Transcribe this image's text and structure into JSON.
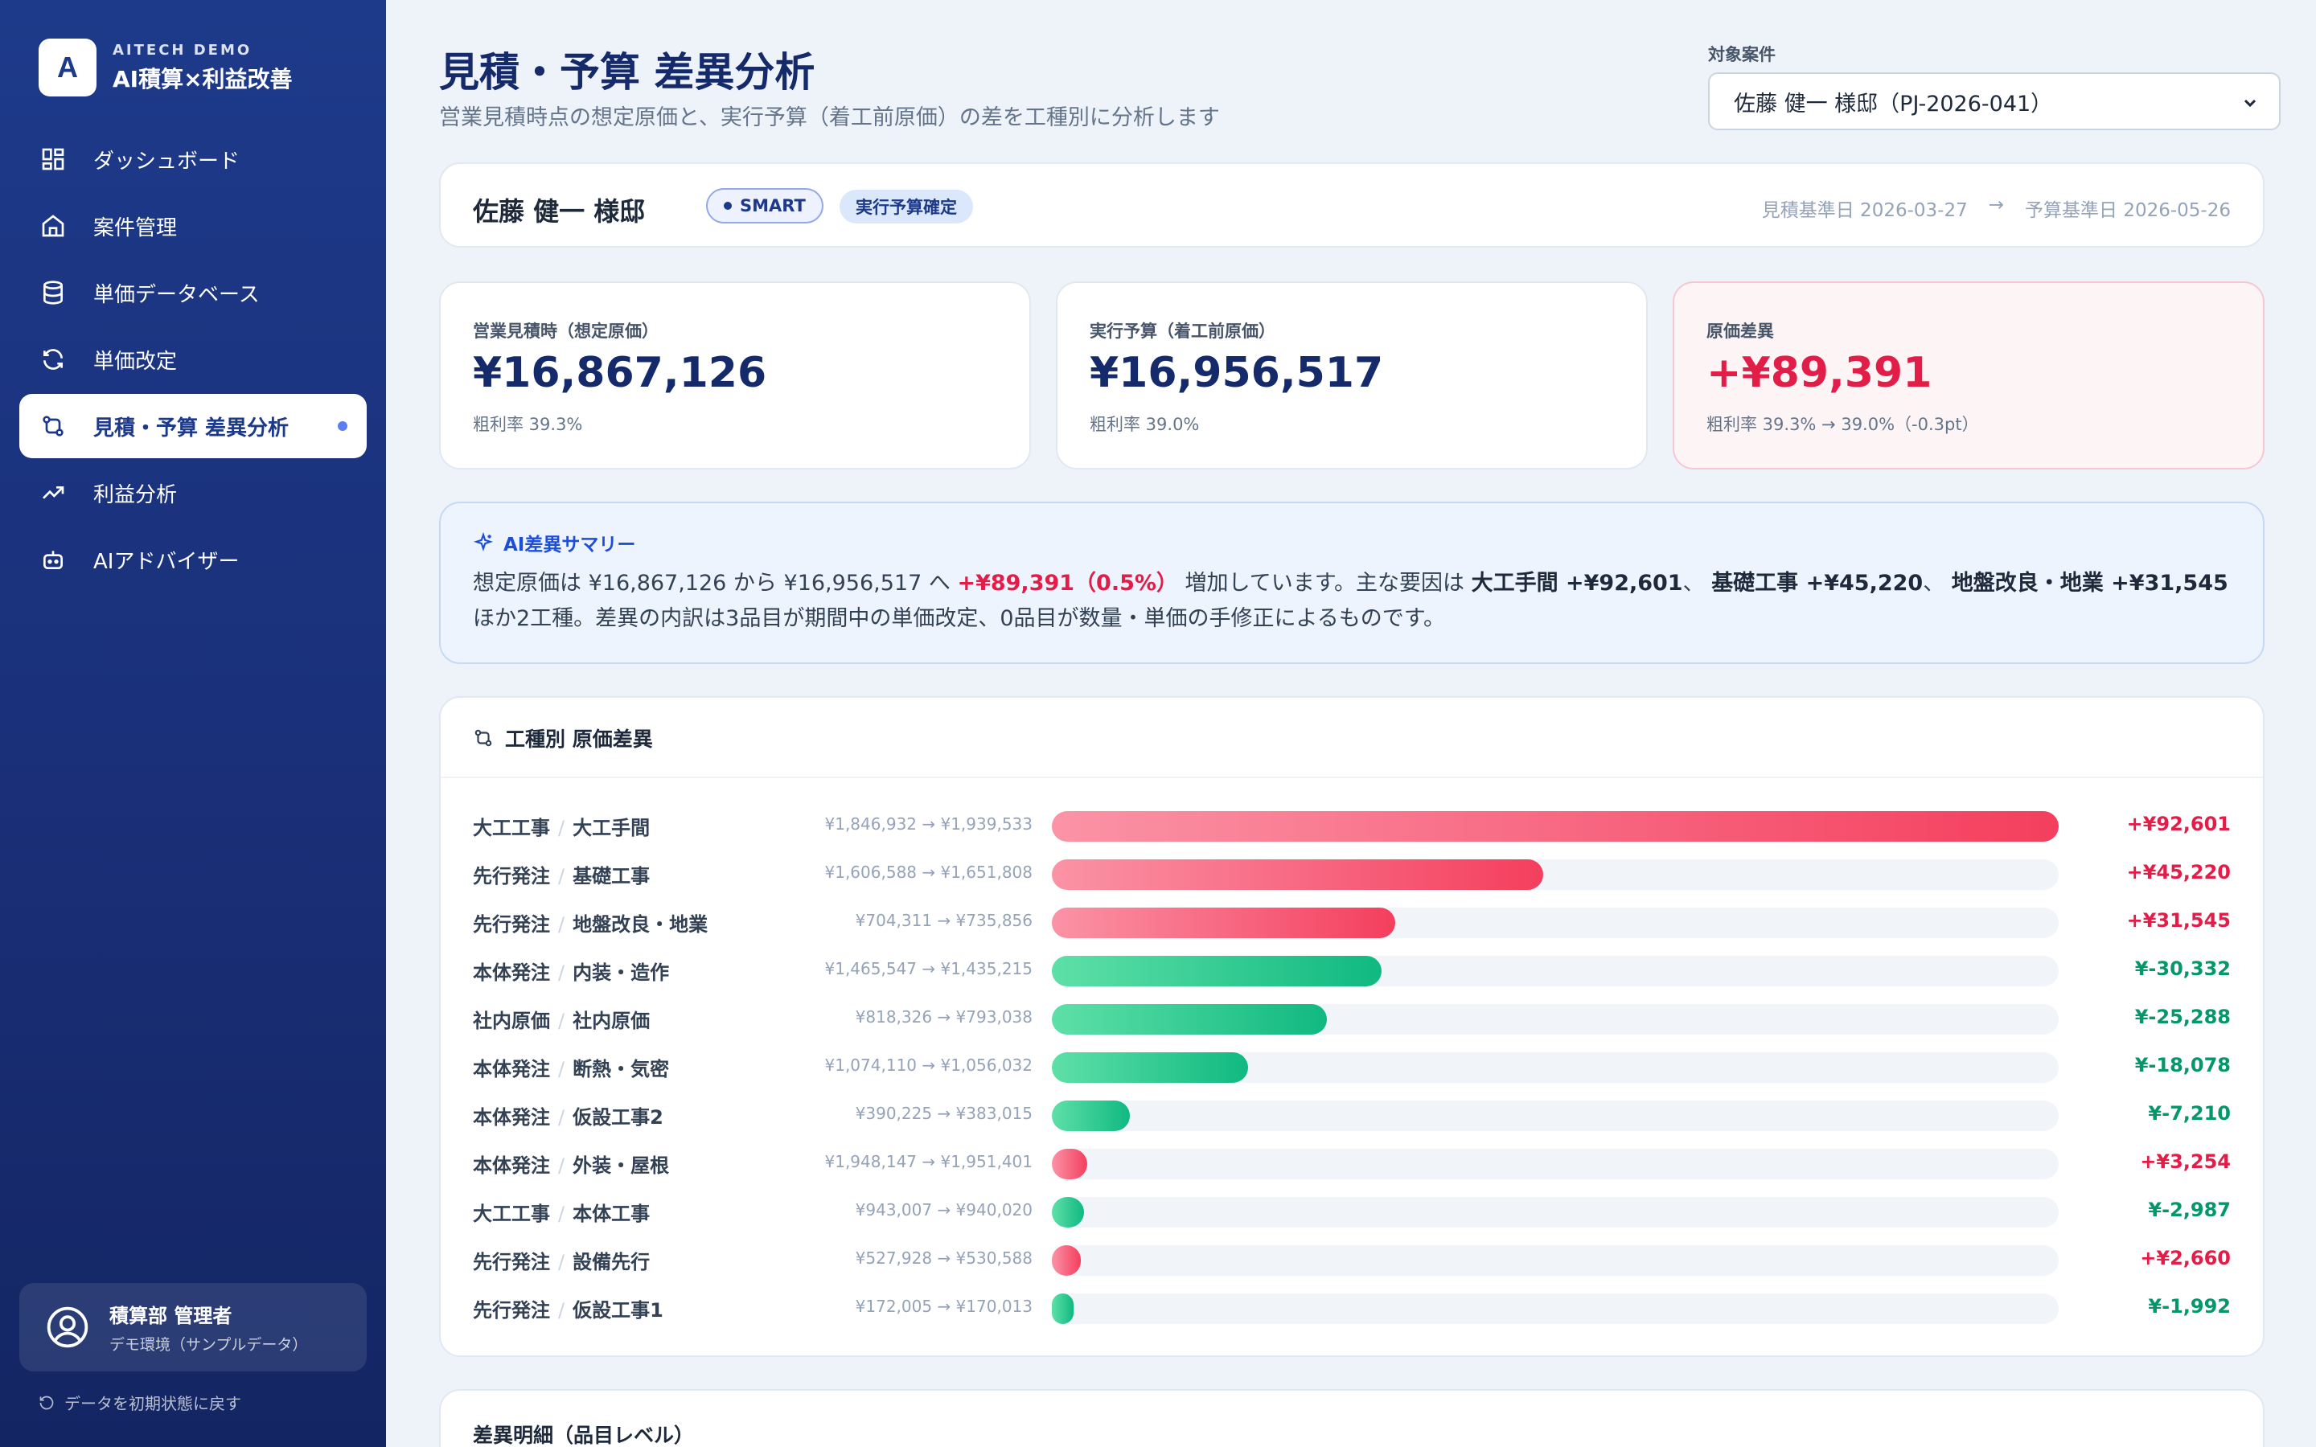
{
  "brand": {
    "logo": "A",
    "sub": "AITECH DEMO",
    "name": "AI積算×利益改善"
  },
  "nav": [
    {
      "label": "ダッシュボード",
      "icon": "dashboard-icon"
    },
    {
      "label": "案件管理",
      "icon": "home-icon"
    },
    {
      "label": "単価データベース",
      "icon": "database-icon"
    },
    {
      "label": "単価改定",
      "icon": "refresh-icon"
    },
    {
      "label": "見積・予算 差異分析",
      "icon": "compare-icon",
      "active": true
    },
    {
      "label": "利益分析",
      "icon": "trend-icon"
    },
    {
      "label": "AIアドバイザー",
      "icon": "robot-icon"
    }
  ],
  "user": {
    "name": "積算部 管理者",
    "env": "デモ環境（サンプルデータ）"
  },
  "reset_label": "データを初期状態に戻す",
  "header": {
    "title": "見積・予算 差異分析",
    "subtitle": "営業見積時点の想定原価と、実行予算（着工前原価）の差を工種別に分析します",
    "target_label": "対象案件",
    "target_value": "佐藤 健一 様邸（PJ-2026-041）"
  },
  "project": {
    "name": "佐藤 健一 様邸",
    "tag": "SMART",
    "status": "実行予算確定",
    "estimate_date": "見積基準日 2026-03-27",
    "arrow": "→",
    "budget_date": "予算基準日 2026-05-26"
  },
  "kpis": {
    "estimate": {
      "label": "営業見積時（想定原価）",
      "value": "¥16,867,126",
      "note": "粗利率 39.3%"
    },
    "budget": {
      "label": "実行予算（着工前原価）",
      "value": "¥16,956,517",
      "note": "粗利率 39.0%"
    },
    "diff": {
      "label": "原価差異",
      "value": "+¥89,391",
      "note": "粗利率 39.3% → 39.0%（-0.3pt）"
    }
  },
  "ai_summary": {
    "title": "AI差異サマリー",
    "t1": "想定原価は ¥16,867,126 から ¥16,956,517 へ ",
    "highlight": "+¥89,391（0.5%）",
    "t2": " 増加しています。主な要因は ",
    "f1": "大工手間 +¥92,601",
    "t3": "、 ",
    "f2": "基礎工事 +¥45,220",
    "t4": "、 ",
    "f3": "地盤改良・地業 +¥31,545",
    "t5": " ほか2工種。差異の内訳は3品目が期間中の単価改定、0品目が数量・単価の手修正によるものです。"
  },
  "chart_title": "工種別 原価差異",
  "chart_data": {
    "type": "bar",
    "max_abs": 92601,
    "rows": [
      {
        "group": "大工工事",
        "name": "大工手間",
        "range": "¥1,846,932 → ¥1,939,533",
        "value": 92601,
        "label": "+¥92,601"
      },
      {
        "group": "先行発注",
        "name": "基礎工事",
        "range": "¥1,606,588 → ¥1,651,808",
        "value": 45220,
        "label": "+¥45,220"
      },
      {
        "group": "先行発注",
        "name": "地盤改良・地業",
        "range": "¥704,311 → ¥735,856",
        "value": 31545,
        "label": "+¥31,545"
      },
      {
        "group": "本体発注",
        "name": "内装・造作",
        "range": "¥1,465,547 → ¥1,435,215",
        "value": -30332,
        "label": "¥-30,332"
      },
      {
        "group": "社内原価",
        "name": "社内原価",
        "range": "¥818,326 → ¥793,038",
        "value": -25288,
        "label": "¥-25,288"
      },
      {
        "group": "本体発注",
        "name": "断熱・気密",
        "range": "¥1,074,110 → ¥1,056,032",
        "value": -18078,
        "label": "¥-18,078"
      },
      {
        "group": "本体発注",
        "name": "仮設工事2",
        "range": "¥390,225 → ¥383,015",
        "value": -7210,
        "label": "¥-7,210"
      },
      {
        "group": "本体発注",
        "name": "外装・屋根",
        "range": "¥1,948,147 → ¥1,951,401",
        "value": 3254,
        "label": "+¥3,254"
      },
      {
        "group": "大工工事",
        "name": "本体工事",
        "range": "¥943,007 → ¥940,020",
        "value": -2987,
        "label": "¥-2,987"
      },
      {
        "group": "先行発注",
        "name": "設備先行",
        "range": "¥527,928 → ¥530,588",
        "value": 2660,
        "label": "+¥2,660"
      },
      {
        "group": "先行発注",
        "name": "仮設工事1",
        "range": "¥172,005 → ¥170,013",
        "value": -1992,
        "label": "¥-1,992"
      }
    ]
  },
  "detail_title": "差異明細（品目レベル）",
  "colors": {
    "primary": "#1d3a8a",
    "increase": "#e11d48",
    "decrease": "#059669"
  }
}
